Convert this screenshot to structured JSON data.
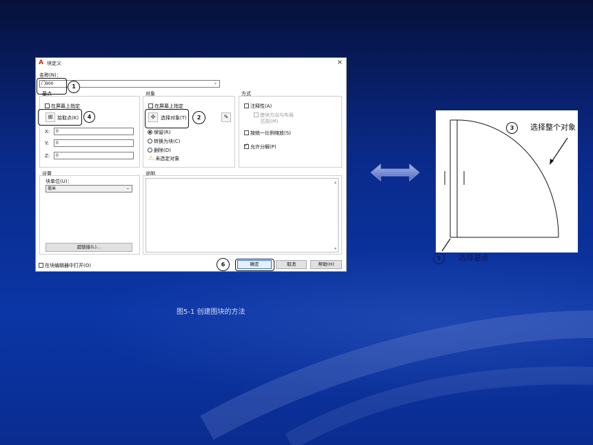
{
  "dialog": {
    "title": "块定义",
    "name_label": "名称(N)：",
    "name_value": "门900",
    "basepoint": {
      "group": "基点",
      "on_screen": "在屏幕上指定",
      "pick_point": "拾取点(K)",
      "x_label": "X:",
      "x_value": "0",
      "y_label": "Y:",
      "y_value": "0",
      "z_label": "Z:",
      "z_value": "0"
    },
    "objects": {
      "group": "对象",
      "on_screen": "在屏幕上指定",
      "select_objects": "选择对象(T)",
      "retain": "保留(R)",
      "convert": "转换为块(C)",
      "delete": "删除(D)",
      "none_selected": "未选定对象"
    },
    "behavior": {
      "group": "方式",
      "annotative": "注释性(A)",
      "match_orientation": "使块方向与布局",
      "match_orientation_2": "匹配(M)",
      "scale_uniform": "按统一比例缩放(S)",
      "allow_explode": "允许分解(P)"
    },
    "settings": {
      "group": "设置",
      "unit_label": "块单位(U)：",
      "unit_value": "毫米",
      "hyperlink": "超链接(L)..."
    },
    "description": {
      "group": "说明"
    },
    "open_in_editor": "在块编辑器中打开(O)",
    "ok": "确定",
    "cancel": "取消",
    "help": "帮助(H)"
  },
  "callouts": [
    "1",
    "2",
    "3",
    "4",
    "5",
    "6"
  ],
  "drawing": {
    "label_select_all": "选择整个对象",
    "label_base_point": "选择基点"
  },
  "caption": "图5-1  创建图块的方法",
  "colors": {
    "background": "#0b36a6",
    "dialog_bg": "#ffffff",
    "primary_border": "#2a6fd6"
  }
}
